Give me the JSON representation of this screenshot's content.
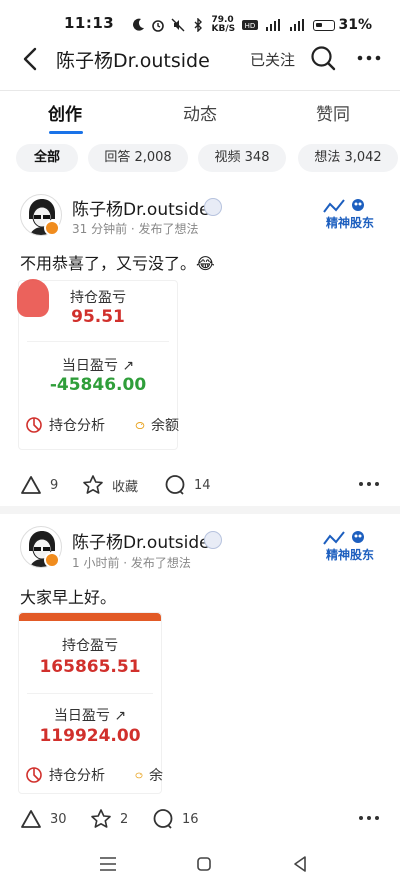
{
  "status": {
    "time": "11:13",
    "speed": "79.0 KB/S",
    "battery": "31%"
  },
  "header": {
    "title": "陈子杨Dr.outside",
    "follow_label": "已关注"
  },
  "tabs": [
    {
      "label": "创作"
    },
    {
      "label": "动态"
    },
    {
      "label": "赞同"
    }
  ],
  "filters": [
    {
      "label": "全部"
    },
    {
      "label": "回答 2,008"
    },
    {
      "label": "视频 348"
    },
    {
      "label": "想法 3,042"
    }
  ],
  "posts": [
    {
      "author": "陈子杨Dr.outside",
      "meta": "31 分钟前 · 发布了想法",
      "sticker": "精神股东",
      "content": "不用恭喜了，又亏没了。😂",
      "card": {
        "label1": "持仓盈亏",
        "value1": "95.51",
        "label2": "当日盈亏 ↗",
        "value2": "-45846.00",
        "foot1": "持仓分析",
        "foot2": "余额"
      },
      "likes": "9",
      "fav_label": "收藏",
      "comments": "14"
    },
    {
      "author": "陈子杨Dr.outside",
      "meta": "1 小时前 · 发布了想法",
      "sticker": "精神股东",
      "content": "大家早上好。",
      "card": {
        "label1": "持仓盈亏",
        "value1": "165865.51",
        "label2": "当日盈亏 ↗",
        "value2": "119924.00",
        "foot1": "持仓分析",
        "foot2": "余"
      },
      "likes": "30",
      "favs": "2",
      "comments": "16"
    }
  ],
  "colors": {
    "accent": "#1a73e8",
    "loss_red": "#d1302c",
    "gain_green": "#2f9e3a"
  }
}
